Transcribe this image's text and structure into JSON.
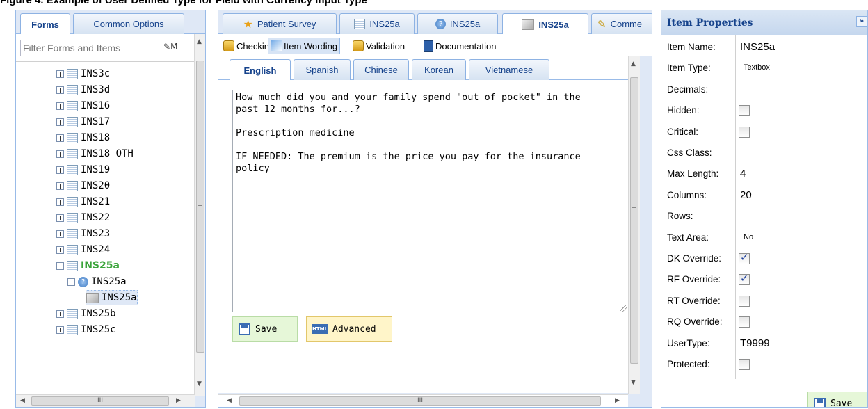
{
  "caption": "Figure 4. Example of User Defined Type for Field with Currency Input Type",
  "left_panel": {
    "tabs": [
      {
        "label": "Forms",
        "active": true
      },
      {
        "label": "Common Options",
        "active": false
      }
    ],
    "filter_placeholder": "Filter Forms and Items",
    "filter_button": "M",
    "tree": [
      {
        "label": "INS3c",
        "level": 0,
        "expander": "plus"
      },
      {
        "label": "INS3d",
        "level": 0,
        "expander": "plus"
      },
      {
        "label": "INS16",
        "level": 0,
        "expander": "plus"
      },
      {
        "label": "INS17",
        "level": 0,
        "expander": "plus"
      },
      {
        "label": "INS18",
        "level": 0,
        "expander": "plus"
      },
      {
        "label": "INS18_OTH",
        "level": 0,
        "expander": "plus"
      },
      {
        "label": "INS19",
        "level": 0,
        "expander": "plus"
      },
      {
        "label": "INS20",
        "level": 0,
        "expander": "plus"
      },
      {
        "label": "INS21",
        "level": 0,
        "expander": "plus"
      },
      {
        "label": "INS22",
        "level": 0,
        "expander": "plus"
      },
      {
        "label": "INS23",
        "level": 0,
        "expander": "plus"
      },
      {
        "label": "INS24",
        "level": 0,
        "expander": "plus"
      },
      {
        "label": "INS25a",
        "level": 0,
        "expander": "minus",
        "bold": true
      },
      {
        "label": "INS25a",
        "level": 1,
        "expander": "minus",
        "icon": "question"
      },
      {
        "label": "INS25a",
        "level": 2,
        "icon": "cube",
        "selected": true
      },
      {
        "label": "INS25b",
        "level": 0,
        "expander": "plus"
      },
      {
        "label": "INS25c",
        "level": 0,
        "expander": "plus"
      }
    ],
    "hscroll_label": "III"
  },
  "mid_panel": {
    "tabs": [
      {
        "label": "Patient Survey",
        "icon": "star-icon"
      },
      {
        "label": "INS25a",
        "icon": "form-icon"
      },
      {
        "label": "INS25a",
        "icon": "question-icon"
      },
      {
        "label": "INS25a",
        "icon": "cube-icon",
        "active": true
      },
      {
        "label": "Comme",
        "icon": "pencil-icon"
      }
    ],
    "toolbar": [
      {
        "label": "Checkin",
        "icon": "lock-icon"
      },
      {
        "label": "Item Wording",
        "icon": "wording-icon",
        "active": true
      },
      {
        "label": "Validation",
        "icon": "lock-icon"
      },
      {
        "label": "Documentation",
        "icon": "document-icon"
      }
    ],
    "languages": [
      {
        "label": "English",
        "active": true
      },
      {
        "label": "Spanish"
      },
      {
        "label": "Chinese"
      },
      {
        "label": "Korean"
      },
      {
        "label": "Vietnamese"
      }
    ],
    "wording_text": "How much did you and your family spend \"out of pocket\" in the\npast 12 months for...?\n\nPrescription medicine\n\nIF NEEDED: The premium is the price you pay for the insurance\npolicy",
    "save_label": "Save",
    "advanced_label": "Advanced",
    "hscroll_label": "III"
  },
  "right_panel": {
    "title": "Item Properties",
    "collapse_label": "»",
    "properties": [
      {
        "key": "Item Name:",
        "value": "INS25a"
      },
      {
        "key": "Item Type:",
        "value": "Textbox",
        "small": true
      },
      {
        "key": "Decimals:",
        "value": ""
      },
      {
        "key": "Hidden:",
        "checkbox": false
      },
      {
        "key": "Critical:",
        "checkbox": false
      },
      {
        "key": "Css Class:",
        "value": ""
      },
      {
        "key": "Max Length:",
        "value": "4"
      },
      {
        "key": "Columns:",
        "value": "20"
      },
      {
        "key": "Rows:",
        "value": ""
      },
      {
        "key": "Text Area:",
        "value": "No",
        "small": true
      },
      {
        "key": "DK Override:",
        "checkbox": true
      },
      {
        "key": "RF Override:",
        "checkbox": true
      },
      {
        "key": "RT Override:",
        "checkbox": false
      },
      {
        "key": "RQ Override:",
        "checkbox": false
      },
      {
        "key": "UserType:",
        "value": "T9999"
      },
      {
        "key": "Protected:",
        "checkbox": false
      }
    ],
    "save_label": "Save"
  }
}
